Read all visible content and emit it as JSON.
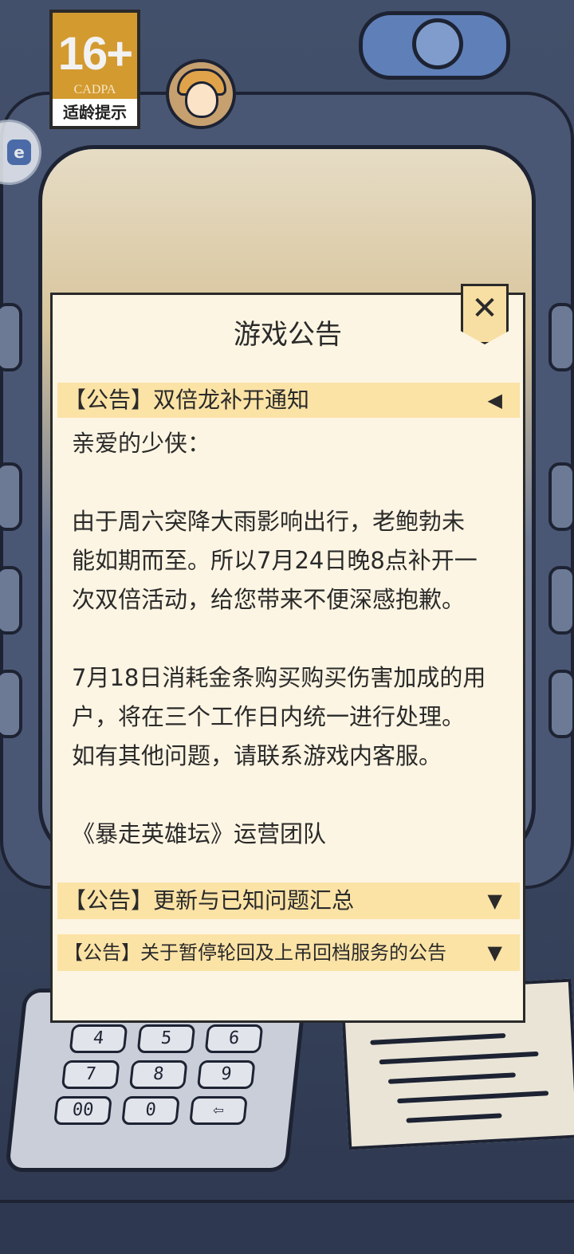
{
  "hud": {
    "age_rating": "16+",
    "age_org": "CADPA",
    "age_hint": "适龄提示"
  },
  "floating_button": {
    "glyph": "e"
  },
  "keypad": {
    "keys": [
      "4",
      "5",
      "6",
      "7",
      "8",
      "9",
      "00",
      "0",
      "⇦"
    ]
  },
  "announcement": {
    "title": "游戏公告",
    "close_glyph": "✕",
    "items": [
      {
        "header": "【公告】双倍龙补开通知",
        "arrow": "◀",
        "expanded": true,
        "body": {
          "greeting": "亲爱的少侠：",
          "p1_l1": "由于周六突降大雨影响出行，老鲍勃未",
          "p1_l2": "能如期而至。所以7月24日晚8点补开一",
          "p1_l3": "次双倍活动，给您带来不便深感抱歉。",
          "p2_l1": "7月18日消耗金条购买购买伤害加成的用",
          "p2_l2": "户，将在三个工作日内统一进行处理。",
          "p2_l3": "如有其他问题，请联系游戏内客服。",
          "signature": "《暴走英雄坛》运营团队"
        }
      },
      {
        "header": "【公告】更新与已知问题汇总",
        "arrow": "▼",
        "expanded": false
      },
      {
        "header": "【公告】关于暂停轮回及上吊回档服务的公告",
        "arrow": "▼",
        "expanded": false
      }
    ]
  }
}
